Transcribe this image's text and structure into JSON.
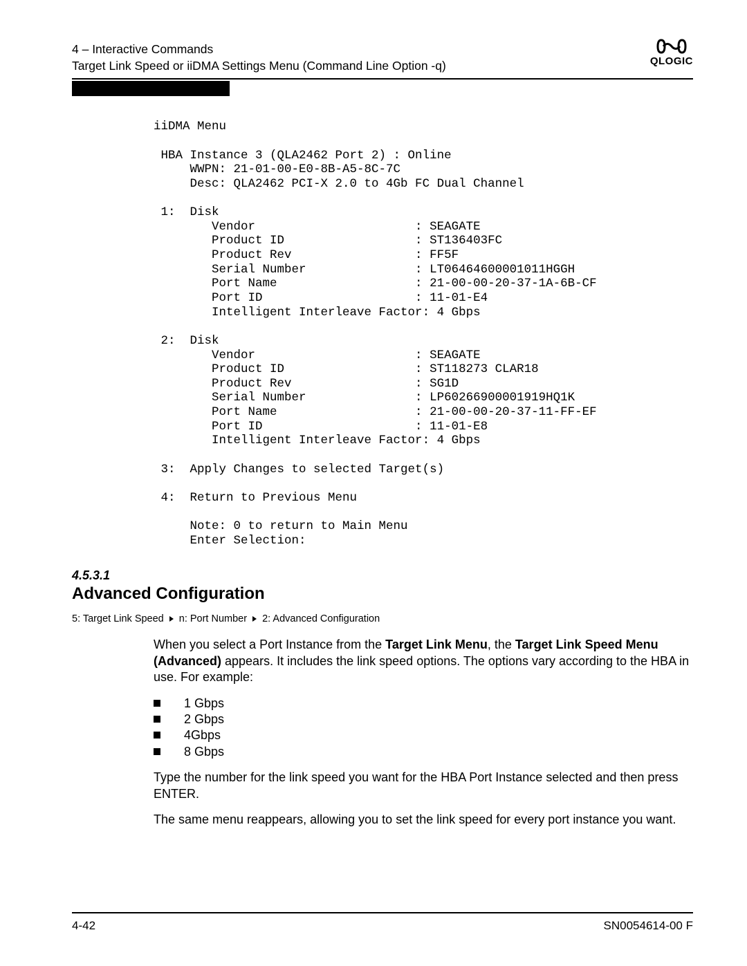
{
  "header": {
    "chapter": "4 – Interactive Commands",
    "subtitle": "Target Link Speed or iiDMA Settings Menu (Command Line Option -q)",
    "logo_text": "QLOGIC"
  },
  "code": {
    "title": "iiDMA Menu",
    "hba_line": " HBA Instance 3 (QLA2462 Port 2) : Online",
    "wwpn": "     WWPN: 21-01-00-E0-8B-A5-8C-7C",
    "desc": "     Desc: QLA2462 PCI-X 2.0 to 4Gb FC Dual Channel",
    "d1_head": " 1:  Disk",
    "d1_vendor": "        Vendor                      : SEAGATE",
    "d1_pid": "        Product ID                  : ST136403FC",
    "d1_rev": "        Product Rev                 : FF5F",
    "d1_sn": "        Serial Number               : LT06464600001011HGGH",
    "d1_pname": "        Port Name                   : 21-00-00-20-37-1A-6B-CF",
    "d1_portid": "        Port ID                     : 11-01-E4",
    "d1_iif": "        Intelligent Interleave Factor: 4 Gbps",
    "d2_head": " 2:  Disk",
    "d2_vendor": "        Vendor                      : SEAGATE",
    "d2_pid": "        Product ID                  : ST118273 CLAR18",
    "d2_rev": "        Product Rev                 : SG1D",
    "d2_sn": "        Serial Number               : LP60266900001919HQ1K",
    "d2_pname": "        Port Name                   : 21-00-00-20-37-11-FF-EF",
    "d2_portid": "        Port ID                     : 11-01-E8",
    "d2_iif": "        Intelligent Interleave Factor: 4 Gbps",
    "opt3": " 3:  Apply Changes to selected Target(s)",
    "opt4": " 4:  Return to Previous Menu",
    "note": "     Note: 0 to return to Main Menu",
    "prompt": "     Enter Selection:"
  },
  "section": {
    "number": "4.5.3.1",
    "title": "Advanced Configuration"
  },
  "breadcrumb": {
    "b1": "5: Target Link Speed",
    "b2": "n: Port Number",
    "b3": "2: Advanced Configuration"
  },
  "body": {
    "p1a": "When you select a Port Instance from the ",
    "p1b": "Target Link Menu",
    "p1c": ", the ",
    "p1d": "Target Link Speed Menu (Advanced)",
    "p1e": " appears. It includes the link speed options. The options vary according to the HBA in use. For example:",
    "bullets": [
      "1 Gbps",
      "2 Gbps",
      "4Gbps",
      "8 Gbps"
    ],
    "p2": "Type the number for the link speed you want for the HBA Port Instance selected and then press ENTER.",
    "p3": "The same menu reappears, allowing you to set the link speed for every port instance you want."
  },
  "footer": {
    "left": "4-42",
    "right": "SN0054614-00  F"
  }
}
